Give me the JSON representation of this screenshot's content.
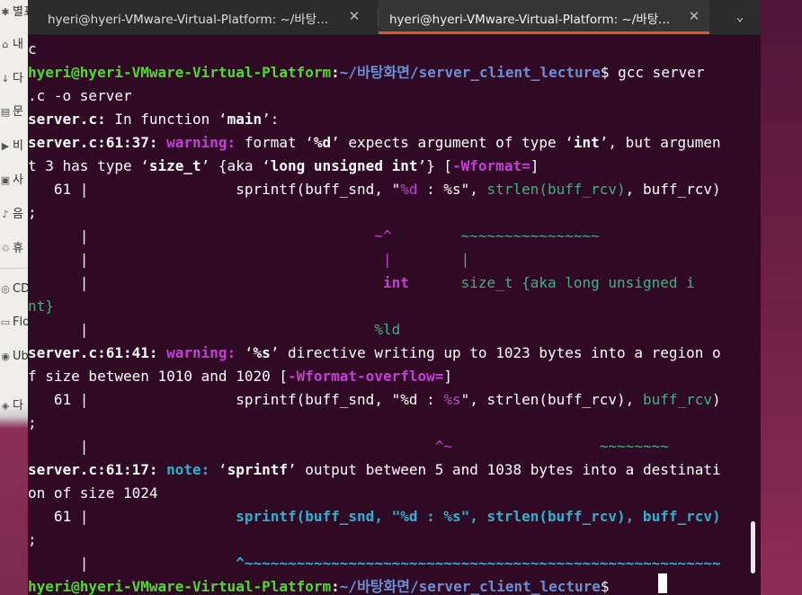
{
  "desktop": {
    "items": [
      {
        "icon": "✱",
        "label": "별표"
      },
      {
        "icon": "⌂",
        "label": "내"
      },
      {
        "icon": "↓",
        "label": "다"
      },
      {
        "icon": "▤",
        "label": "문"
      },
      {
        "icon": "▶",
        "label": "비"
      },
      {
        "icon": "▣",
        "label": "사"
      },
      {
        "icon": "♪",
        "label": "음"
      },
      {
        "icon": "♲",
        "label": "휴"
      },
      {
        "icon": "◎",
        "label": "CD"
      },
      {
        "icon": "▭",
        "label": "Flo"
      },
      {
        "icon": "◉",
        "label": "Ub"
      },
      {
        "icon": "◈",
        "label": "다"
      }
    ]
  },
  "tabs": [
    {
      "title": "hyeri@hyeri-VMware-Virtual-Platform: ~/바탕...",
      "close": "✕"
    },
    {
      "title": "hyeri@hyeri-VMware-Virtual-Platform: ~/바탕...",
      "close": "✕"
    }
  ],
  "menu_icon": "chevron-down-icon",
  "menu_glyph": "⌄",
  "terminal": {
    "user": "hyeri@hyeri-VMware-Virtual-Platform",
    "path": "~/바탕화면/server_client_lecture",
    "command_part1": " gcc server",
    "command_part2": ".c -o server",
    "prev_tail": "c",
    "in_function_file": "server.c:",
    "in_function_text": " In function ‘",
    "in_function_name": "main",
    "in_function_end": "’:",
    "w1_loc": "server.c:61:37: ",
    "warning_label": "warning: ",
    "w1_t1": "format ‘",
    "w1_fmt": "%d",
    "w1_t2": "’ expects argument of type ‘",
    "w1_int": "int",
    "w1_t3": "’, but argumen",
    "w1_t4": "t 3 has type ‘",
    "w1_sizet": "size_t",
    "w1_t5": "’ {aka ‘",
    "w1_lu": "long unsigned int",
    "w1_t6": "’} [",
    "w1_flag": "-Wformat=",
    "w1_t7": "]",
    "code_prefix": "   61 |                 ",
    "code_a": "sprintf(buff_snd, \"",
    "code_b": "%d",
    "code_c": " : %s\", ",
    "code_d": "strlen(buff_rcv)",
    "code_e": ", buff_rcv)",
    "semi": ";",
    "gutter": "      |",
    "ann1_sp": "                                 ",
    "ann1_mark": "~^",
    "ann1_sp2": "        ",
    "ann1_tilde": "~~~~~~~~~~~~~~~~",
    "ann2_sp": "                                  ",
    "ann2_bar": "|",
    "ann2_sp2": "        ",
    "ann2_bar2": "|",
    "ann3_sp": "                                  ",
    "ann3_int": "int",
    "ann3_sp2": "      ",
    "ann3_type": "size_t {aka long unsigned i",
    "ann3_wrap": "nt}",
    "ann4_sp": "                                 ",
    "ann4_fix": "%ld",
    "w2_loc": "server.c:61:41: ",
    "w2_t1": "‘",
    "w2_fmt": "%s",
    "w2_t2": "’ directive writing up to 1023 bytes into a region o",
    "w2_t3": "f size between 1010 and 1020 [",
    "w2_flag": "-Wformat-overflow=",
    "w2_t4": "]",
    "code2_a": "sprintf(buff_snd, \"%d : ",
    "code2_b": "%s",
    "code2_c": "\", strlen(buff_rcv), ",
    "code2_d": "buff_rcv",
    "code2_e": ")",
    "ann5_sp": "                                        ",
    "ann5_mark": "^~",
    "ann5_sp2": "                 ",
    "ann5_tilde": "~~~~~~~~",
    "n_loc": "server.c:61:17: ",
    "note_label": "note: ",
    "n_t1": "‘",
    "n_fn": "sprintf",
    "n_t2": "’ output between 5 and 1038 bytes into a destinati",
    "n_t3": "on of size 1024",
    "code3": "sprintf(buff_snd, \"%d : %s\", strlen(buff_rcv), buff_rcv)",
    "ann6_sp": "                 ",
    "ann6_mark": "^~~~~~~~~~~~~~~~~~~~~~~~~~~~~~~~~~~~~~~~~~~~~~~~~~~~~~~~",
    "dollar": "$",
    "prompt_colon": ":"
  }
}
